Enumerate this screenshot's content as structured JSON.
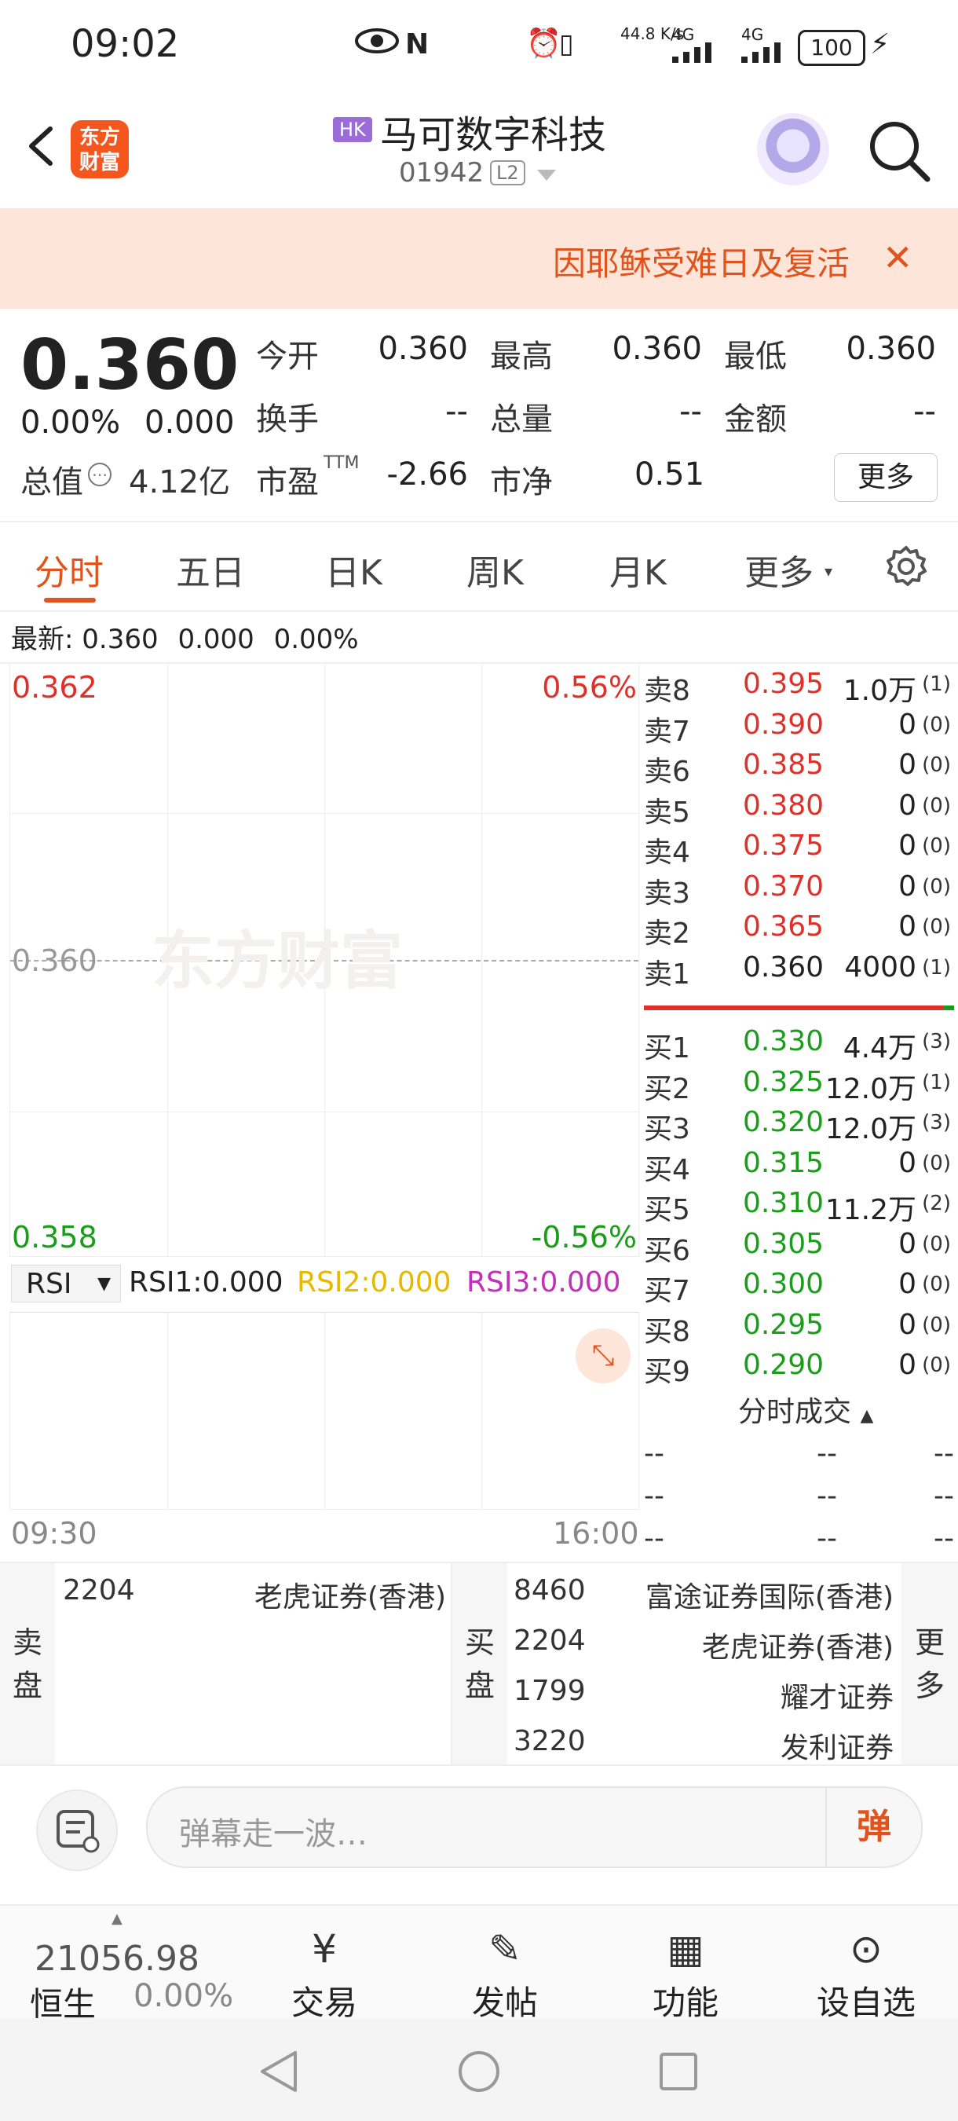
{
  "status_bar": {
    "time": "09:02",
    "net_speed": "44.8 K/s",
    "signal1": "4G",
    "signal2": "4G",
    "battery": "100"
  },
  "header": {
    "logo_text": "东方财富",
    "market_badge": "HK",
    "stock_name": "马可数字科技",
    "stock_code": "01942",
    "level_badge": "L2"
  },
  "banner": {
    "text": "因耶稣受难日及复活",
    "close": "✕"
  },
  "quote": {
    "price": "0.360",
    "change_pct": "0.00%",
    "change_abs": "0.000",
    "open_label": "今开",
    "open": "0.360",
    "high_label": "最高",
    "high": "0.360",
    "low_label": "最低",
    "low": "0.360",
    "turnover_label": "换手",
    "turnover": "--",
    "volume_label": "总量",
    "volume": "--",
    "amount_label": "金额",
    "amount": "--",
    "mktcap_label": "总值",
    "mktcap": "4.12亿",
    "pe_label": "市盈",
    "pe_sup": "TTM",
    "pe": "-2.66",
    "pb_label": "市净",
    "pb": "0.51",
    "more_button": "更多"
  },
  "tabs": [
    "分时",
    "五日",
    "日K",
    "周K",
    "月K",
    "更多"
  ],
  "latest": {
    "label": "最新:",
    "price": "0.360",
    "change": "0.000",
    "pct": "0.00%"
  },
  "chart": {
    "y_top": "0.362",
    "y_mid": "0.360",
    "y_bottom": "0.358",
    "pct_top": "0.56%",
    "pct_bottom": "-0.56%",
    "watermark": "东方财富",
    "time_start": "09:30",
    "time_end": "16:00"
  },
  "rsi": {
    "selector": "RSI",
    "rsi1": "RSI1:0.000",
    "rsi2": "RSI2:0.000",
    "rsi3": "RSI3:0.000"
  },
  "order_book": {
    "asks": [
      {
        "label": "卖8",
        "price": "0.395",
        "volume": "1.0万",
        "count": "(1)"
      },
      {
        "label": "卖7",
        "price": "0.390",
        "volume": "0",
        "count": "(0)"
      },
      {
        "label": "卖6",
        "price": "0.385",
        "volume": "0",
        "count": "(0)"
      },
      {
        "label": "卖5",
        "price": "0.380",
        "volume": "0",
        "count": "(0)"
      },
      {
        "label": "卖4",
        "price": "0.375",
        "volume": "0",
        "count": "(0)"
      },
      {
        "label": "卖3",
        "price": "0.370",
        "volume": "0",
        "count": "(0)"
      },
      {
        "label": "卖2",
        "price": "0.365",
        "volume": "0",
        "count": "(0)"
      },
      {
        "label": "卖1",
        "price": "0.360",
        "volume": "4000",
        "count": "(1)"
      }
    ],
    "bids": [
      {
        "label": "买1",
        "price": "0.330",
        "volume": "4.4万",
        "count": "(3)"
      },
      {
        "label": "买2",
        "price": "0.325",
        "volume": "12.0万",
        "count": "(1)"
      },
      {
        "label": "买3",
        "price": "0.320",
        "volume": "12.0万",
        "count": "(3)"
      },
      {
        "label": "买4",
        "price": "0.315",
        "volume": "0",
        "count": "(0)"
      },
      {
        "label": "买5",
        "price": "0.310",
        "volume": "11.2万",
        "count": "(2)"
      },
      {
        "label": "买6",
        "price": "0.305",
        "volume": "0",
        "count": "(0)"
      },
      {
        "label": "买7",
        "price": "0.300",
        "volume": "0",
        "count": "(0)"
      },
      {
        "label": "买8",
        "price": "0.295",
        "volume": "0",
        "count": "(0)"
      },
      {
        "label": "买9",
        "price": "0.290",
        "volume": "0",
        "count": "(0)"
      }
    ]
  },
  "trades": {
    "title": "分时成交",
    "rows": [
      [
        "--",
        "--",
        "--"
      ],
      [
        "--",
        "--",
        "--"
      ],
      [
        "--",
        "--",
        "--"
      ]
    ]
  },
  "brokers": {
    "sell_label": "卖盘",
    "buy_label": "买盘",
    "more_label": "更多",
    "sell": [
      {
        "id": "2204",
        "name": "老虎证券(香港)"
      }
    ],
    "buy": [
      {
        "id": "8460",
        "name": "富途证券国际(香港)"
      },
      {
        "id": "2204",
        "name": "老虎证券(香港)"
      },
      {
        "id": "1799",
        "name": "耀才证券"
      },
      {
        "id": "3220",
        "name": "发利证券"
      }
    ]
  },
  "comment": {
    "placeholder": "弹幕走一波…",
    "danmu_button": "弹"
  },
  "bottom_nav": {
    "index_value": "21056.98",
    "index_name": "恒生",
    "index_pct": "0.00%",
    "items": [
      "交易",
      "发帖",
      "功能",
      "设自选"
    ]
  }
}
